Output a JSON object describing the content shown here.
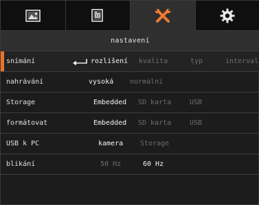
{
  "tabs": [
    {
      "icon": "photo-icon",
      "active": false
    },
    {
      "icon": "camera-card-icon",
      "active": false
    },
    {
      "icon": "tools-icon",
      "active": true
    },
    {
      "icon": "gear-icon",
      "active": false
    }
  ],
  "header": {
    "title": "nastavení"
  },
  "menu": {
    "rows": [
      {
        "label": "snímání",
        "options": [
          "rozlišení",
          "kvalita",
          "typ",
          "interval"
        ],
        "selected": 0
      },
      {
        "label": "nahrávání",
        "options": [
          "vysoká",
          "normální"
        ],
        "selected": 0
      },
      {
        "label": "Storage",
        "options": [
          "Embedded",
          "SD karta",
          "USB"
        ],
        "selected": 0
      },
      {
        "label": "formátovat",
        "options": [
          "Embedded",
          "SD karta",
          "USB"
        ],
        "selected": 0
      },
      {
        "label": "USB k PC",
        "options": [
          "kamera",
          "Storage"
        ],
        "selected": 0
      },
      {
        "label": "blikání",
        "options": [
          "50 Hz",
          "60 Hz"
        ],
        "selected": 1
      }
    ]
  },
  "colors": {
    "accent": "#e8742a",
    "background": "#1c1c1c",
    "active_tab": "#2f2f2f",
    "dim_text": "#6e6e6e"
  }
}
